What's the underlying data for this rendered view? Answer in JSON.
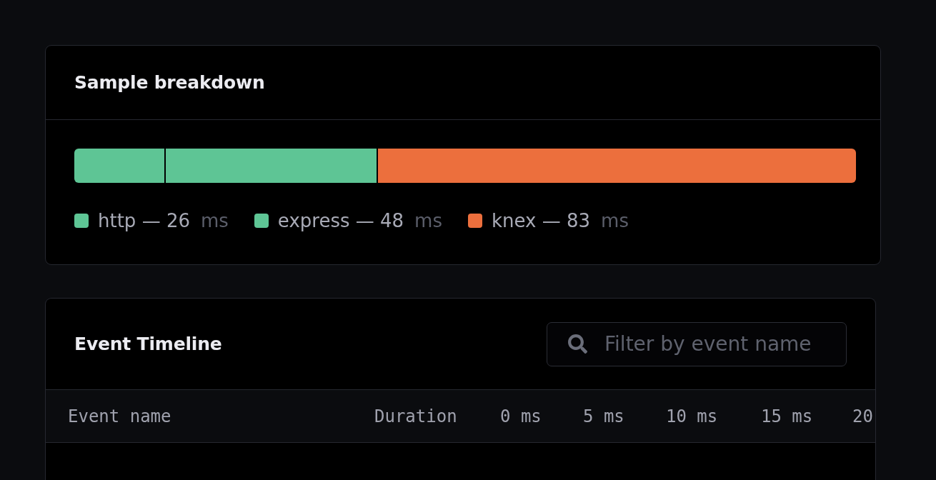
{
  "breakdown": {
    "title": "Sample breakdown",
    "segments": [
      {
        "label": "http — 26",
        "unit": "ms",
        "color": "#5ec595",
        "level": 0.116
      },
      {
        "label": "express — 48",
        "unit": "ms",
        "color": "#5ec595",
        "level": 0.27
      },
      {
        "label": "knex — 83",
        "unit": "ms",
        "color": "#ec6f3d",
        "level": 0.614
      }
    ]
  },
  "timeline": {
    "title": "Event Timeline",
    "search": {
      "placeholder": "Filter by event name"
    },
    "table": {
      "columns": [
        "Event name",
        "Duration",
        "0 ms",
        "5 ms",
        "10 ms",
        "15 ms",
        "20"
      ]
    }
  }
}
